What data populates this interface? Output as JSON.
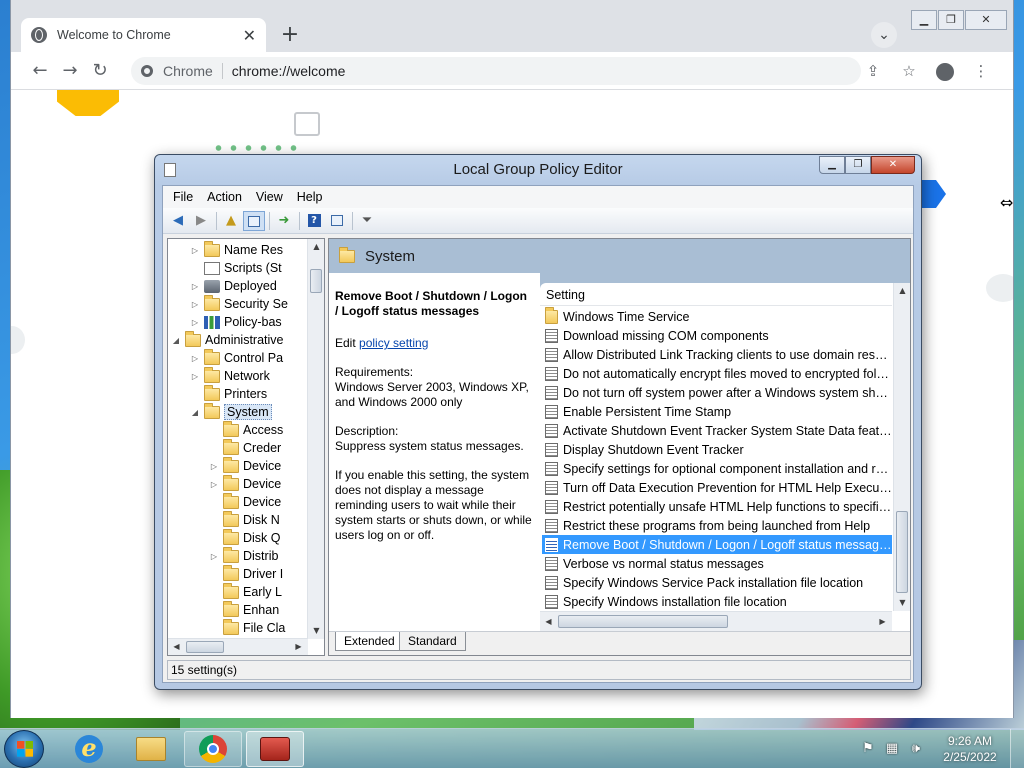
{
  "chrome": {
    "tab_title": "Welcome to Chrome",
    "omnibox_site": "Chrome",
    "omnibox_url": "chrome://welcome"
  },
  "gpe": {
    "title": "Local Group Policy Editor",
    "menu": [
      "File",
      "Action",
      "View",
      "Help"
    ],
    "tree": [
      {
        "label": "Name Res",
        "icon": "folder",
        "expander": "collapsed",
        "indent": 3
      },
      {
        "label": "Scripts (St",
        "icon": "script",
        "expander": "none",
        "indent": 3
      },
      {
        "label": "Deployed",
        "icon": "printer",
        "expander": "collapsed",
        "indent": 3
      },
      {
        "label": "Security Se",
        "icon": "folder",
        "expander": "collapsed",
        "indent": 3
      },
      {
        "label": "Policy-bas",
        "icon": "chart",
        "expander": "collapsed",
        "indent": 3
      },
      {
        "label": "Administrative",
        "icon": "folder",
        "expander": "expanded",
        "indent": 2
      },
      {
        "label": "Control Pa",
        "icon": "folder",
        "expander": "collapsed",
        "indent": 3
      },
      {
        "label": "Network",
        "icon": "folder",
        "expander": "collapsed",
        "indent": 3
      },
      {
        "label": "Printers",
        "icon": "folder",
        "expander": "none",
        "indent": 3
      },
      {
        "label": "System",
        "icon": "folder",
        "expander": "expanded",
        "indent": 3,
        "selected": true
      },
      {
        "label": "Access",
        "icon": "folder",
        "expander": "none",
        "indent": 4
      },
      {
        "label": "Creder",
        "icon": "folder",
        "expander": "none",
        "indent": 4
      },
      {
        "label": "Device",
        "icon": "folder",
        "expander": "collapsed",
        "indent": 4
      },
      {
        "label": "Device",
        "icon": "folder",
        "expander": "collapsed",
        "indent": 4
      },
      {
        "label": "Device",
        "icon": "folder",
        "expander": "none",
        "indent": 4
      },
      {
        "label": "Disk N",
        "icon": "folder",
        "expander": "none",
        "indent": 4
      },
      {
        "label": "Disk Q",
        "icon": "folder",
        "expander": "none",
        "indent": 4
      },
      {
        "label": "Distrib",
        "icon": "folder",
        "expander": "collapsed",
        "indent": 4
      },
      {
        "label": "Driver I",
        "icon": "folder",
        "expander": "none",
        "indent": 4
      },
      {
        "label": "Early L",
        "icon": "folder",
        "expander": "none",
        "indent": 4
      },
      {
        "label": "Enhan",
        "icon": "folder",
        "expander": "none",
        "indent": 4
      },
      {
        "label": "File Cla",
        "icon": "folder",
        "expander": "none",
        "indent": 4
      }
    ],
    "header_title": "System",
    "extended": {
      "setting_title": "Remove Boot / Shutdown / Logon / Logoff status messages",
      "edit_prefix": "Edit ",
      "edit_link": "policy setting",
      "requirements_label": "Requirements:",
      "requirements_text": "Windows Server 2003, Windows XP, and Windows 2000 only",
      "description_label": "Description:",
      "description_text": "Suppress system status messages.",
      "detail_text": "If you enable this setting, the system does not display a message reminding users to wait while their system starts or shuts down, or while users log on or off."
    },
    "column_header": "Setting",
    "settings": [
      {
        "label": "Windows Time Service",
        "icon": "folder"
      },
      {
        "label": "Download missing COM components",
        "icon": "setting"
      },
      {
        "label": "Allow Distributed Link Tracking clients to use domain resour...",
        "icon": "setting"
      },
      {
        "label": "Do not automatically encrypt files moved to encrypted fold...",
        "icon": "setting"
      },
      {
        "label": "Do not turn off system power after a Windows system shutd...",
        "icon": "setting"
      },
      {
        "label": "Enable Persistent Time Stamp",
        "icon": "setting"
      },
      {
        "label": "Activate Shutdown Event Tracker System State Data feature",
        "icon": "setting"
      },
      {
        "label": "Display Shutdown Event Tracker",
        "icon": "setting"
      },
      {
        "label": "Specify settings for optional component installation and rep...",
        "icon": "setting"
      },
      {
        "label": "Turn off Data Execution Prevention for HTML Help Executible",
        "icon": "setting"
      },
      {
        "label": "Restrict potentially unsafe HTML Help functions to specified...",
        "icon": "setting"
      },
      {
        "label": "Restrict these programs from being launched from Help",
        "icon": "setting"
      },
      {
        "label": "Remove Boot / Shutdown / Logon / Logoff status messages",
        "icon": "setting",
        "selected": true
      },
      {
        "label": "Verbose vs normal status messages",
        "icon": "setting"
      },
      {
        "label": "Specify Windows Service Pack installation file location",
        "icon": "setting"
      },
      {
        "label": "Specify Windows installation file location",
        "icon": "setting"
      }
    ],
    "view_tabs": [
      "Extended",
      "Standard"
    ],
    "status": "15 setting(s)"
  },
  "taskbar": {
    "time": "9:26 AM",
    "date": "2/25/2022",
    "apps": [
      "internet-explorer",
      "windows-explorer",
      "google-chrome",
      "group-policy-editor"
    ]
  }
}
